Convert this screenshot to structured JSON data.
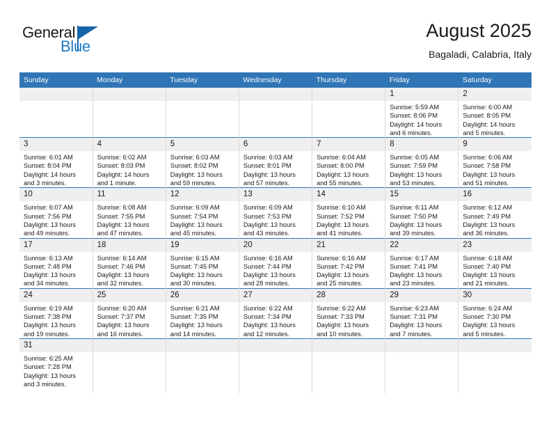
{
  "brand": {
    "name_top": "General",
    "name_bottom": "Blue",
    "flag_color": "#1565a8",
    "text_color": "#1f7ac4"
  },
  "header": {
    "title": "August 2025",
    "subtitle": "Bagaladi, Calabria, Italy"
  },
  "theme": {
    "header_blue": "#3075b5",
    "daynum_bg": "#efefef",
    "cell_border": "#d9d9d9"
  },
  "weekdays": [
    "Sunday",
    "Monday",
    "Tuesday",
    "Wednesday",
    "Thursday",
    "Friday",
    "Saturday"
  ],
  "weeks": [
    [
      {
        "day": "",
        "sunrise": "",
        "sunset": "",
        "daylight_1": "",
        "daylight_2": ""
      },
      {
        "day": "",
        "sunrise": "",
        "sunset": "",
        "daylight_1": "",
        "daylight_2": ""
      },
      {
        "day": "",
        "sunrise": "",
        "sunset": "",
        "daylight_1": "",
        "daylight_2": ""
      },
      {
        "day": "",
        "sunrise": "",
        "sunset": "",
        "daylight_1": "",
        "daylight_2": ""
      },
      {
        "day": "",
        "sunrise": "",
        "sunset": "",
        "daylight_1": "",
        "daylight_2": ""
      },
      {
        "day": "1",
        "sunrise": "Sunrise: 5:59 AM",
        "sunset": "Sunset: 8:06 PM",
        "daylight_1": "Daylight: 14 hours",
        "daylight_2": "and 6 minutes."
      },
      {
        "day": "2",
        "sunrise": "Sunrise: 6:00 AM",
        "sunset": "Sunset: 8:05 PM",
        "daylight_1": "Daylight: 14 hours",
        "daylight_2": "and 5 minutes."
      }
    ],
    [
      {
        "day": "3",
        "sunrise": "Sunrise: 6:01 AM",
        "sunset": "Sunset: 8:04 PM",
        "daylight_1": "Daylight: 14 hours",
        "daylight_2": "and 3 minutes."
      },
      {
        "day": "4",
        "sunrise": "Sunrise: 6:02 AM",
        "sunset": "Sunset: 8:03 PM",
        "daylight_1": "Daylight: 14 hours",
        "daylight_2": "and 1 minute."
      },
      {
        "day": "5",
        "sunrise": "Sunrise: 6:03 AM",
        "sunset": "Sunset: 8:02 PM",
        "daylight_1": "Daylight: 13 hours",
        "daylight_2": "and 59 minutes."
      },
      {
        "day": "6",
        "sunrise": "Sunrise: 6:03 AM",
        "sunset": "Sunset: 8:01 PM",
        "daylight_1": "Daylight: 13 hours",
        "daylight_2": "and 57 minutes."
      },
      {
        "day": "7",
        "sunrise": "Sunrise: 6:04 AM",
        "sunset": "Sunset: 8:00 PM",
        "daylight_1": "Daylight: 13 hours",
        "daylight_2": "and 55 minutes."
      },
      {
        "day": "8",
        "sunrise": "Sunrise: 6:05 AM",
        "sunset": "Sunset: 7:59 PM",
        "daylight_1": "Daylight: 13 hours",
        "daylight_2": "and 53 minutes."
      },
      {
        "day": "9",
        "sunrise": "Sunrise: 6:06 AM",
        "sunset": "Sunset: 7:58 PM",
        "daylight_1": "Daylight: 13 hours",
        "daylight_2": "and 51 minutes."
      }
    ],
    [
      {
        "day": "10",
        "sunrise": "Sunrise: 6:07 AM",
        "sunset": "Sunset: 7:56 PM",
        "daylight_1": "Daylight: 13 hours",
        "daylight_2": "and 49 minutes."
      },
      {
        "day": "11",
        "sunrise": "Sunrise: 6:08 AM",
        "sunset": "Sunset: 7:55 PM",
        "daylight_1": "Daylight: 13 hours",
        "daylight_2": "and 47 minutes."
      },
      {
        "day": "12",
        "sunrise": "Sunrise: 6:09 AM",
        "sunset": "Sunset: 7:54 PM",
        "daylight_1": "Daylight: 13 hours",
        "daylight_2": "and 45 minutes."
      },
      {
        "day": "13",
        "sunrise": "Sunrise: 6:09 AM",
        "sunset": "Sunset: 7:53 PM",
        "daylight_1": "Daylight: 13 hours",
        "daylight_2": "and 43 minutes."
      },
      {
        "day": "14",
        "sunrise": "Sunrise: 6:10 AM",
        "sunset": "Sunset: 7:52 PM",
        "daylight_1": "Daylight: 13 hours",
        "daylight_2": "and 41 minutes."
      },
      {
        "day": "15",
        "sunrise": "Sunrise: 6:11 AM",
        "sunset": "Sunset: 7:50 PM",
        "daylight_1": "Daylight: 13 hours",
        "daylight_2": "and 39 minutes."
      },
      {
        "day": "16",
        "sunrise": "Sunrise: 6:12 AM",
        "sunset": "Sunset: 7:49 PM",
        "daylight_1": "Daylight: 13 hours",
        "daylight_2": "and 36 minutes."
      }
    ],
    [
      {
        "day": "17",
        "sunrise": "Sunrise: 6:13 AM",
        "sunset": "Sunset: 7:48 PM",
        "daylight_1": "Daylight: 13 hours",
        "daylight_2": "and 34 minutes."
      },
      {
        "day": "18",
        "sunrise": "Sunrise: 6:14 AM",
        "sunset": "Sunset: 7:46 PM",
        "daylight_1": "Daylight: 13 hours",
        "daylight_2": "and 32 minutes."
      },
      {
        "day": "19",
        "sunrise": "Sunrise: 6:15 AM",
        "sunset": "Sunset: 7:45 PM",
        "daylight_1": "Daylight: 13 hours",
        "daylight_2": "and 30 minutes."
      },
      {
        "day": "20",
        "sunrise": "Sunrise: 6:16 AM",
        "sunset": "Sunset: 7:44 PM",
        "daylight_1": "Daylight: 13 hours",
        "daylight_2": "and 28 minutes."
      },
      {
        "day": "21",
        "sunrise": "Sunrise: 6:16 AM",
        "sunset": "Sunset: 7:42 PM",
        "daylight_1": "Daylight: 13 hours",
        "daylight_2": "and 25 minutes."
      },
      {
        "day": "22",
        "sunrise": "Sunrise: 6:17 AM",
        "sunset": "Sunset: 7:41 PM",
        "daylight_1": "Daylight: 13 hours",
        "daylight_2": "and 23 minutes."
      },
      {
        "day": "23",
        "sunrise": "Sunrise: 6:18 AM",
        "sunset": "Sunset: 7:40 PM",
        "daylight_1": "Daylight: 13 hours",
        "daylight_2": "and 21 minutes."
      }
    ],
    [
      {
        "day": "24",
        "sunrise": "Sunrise: 6:19 AM",
        "sunset": "Sunset: 7:38 PM",
        "daylight_1": "Daylight: 13 hours",
        "daylight_2": "and 19 minutes."
      },
      {
        "day": "25",
        "sunrise": "Sunrise: 6:20 AM",
        "sunset": "Sunset: 7:37 PM",
        "daylight_1": "Daylight: 13 hours",
        "daylight_2": "and 16 minutes."
      },
      {
        "day": "26",
        "sunrise": "Sunrise: 6:21 AM",
        "sunset": "Sunset: 7:35 PM",
        "daylight_1": "Daylight: 13 hours",
        "daylight_2": "and 14 minutes."
      },
      {
        "day": "27",
        "sunrise": "Sunrise: 6:22 AM",
        "sunset": "Sunset: 7:34 PM",
        "daylight_1": "Daylight: 13 hours",
        "daylight_2": "and 12 minutes."
      },
      {
        "day": "28",
        "sunrise": "Sunrise: 6:22 AM",
        "sunset": "Sunset: 7:33 PM",
        "daylight_1": "Daylight: 13 hours",
        "daylight_2": "and 10 minutes."
      },
      {
        "day": "29",
        "sunrise": "Sunrise: 6:23 AM",
        "sunset": "Sunset: 7:31 PM",
        "daylight_1": "Daylight: 13 hours",
        "daylight_2": "and 7 minutes."
      },
      {
        "day": "30",
        "sunrise": "Sunrise: 6:24 AM",
        "sunset": "Sunset: 7:30 PM",
        "daylight_1": "Daylight: 13 hours",
        "daylight_2": "and 5 minutes."
      }
    ],
    [
      {
        "day": "31",
        "sunrise": "Sunrise: 6:25 AM",
        "sunset": "Sunset: 7:28 PM",
        "daylight_1": "Daylight: 13 hours",
        "daylight_2": "and 3 minutes."
      },
      {
        "day": "",
        "sunrise": "",
        "sunset": "",
        "daylight_1": "",
        "daylight_2": ""
      },
      {
        "day": "",
        "sunrise": "",
        "sunset": "",
        "daylight_1": "",
        "daylight_2": ""
      },
      {
        "day": "",
        "sunrise": "",
        "sunset": "",
        "daylight_1": "",
        "daylight_2": ""
      },
      {
        "day": "",
        "sunrise": "",
        "sunset": "",
        "daylight_1": "",
        "daylight_2": ""
      },
      {
        "day": "",
        "sunrise": "",
        "sunset": "",
        "daylight_1": "",
        "daylight_2": ""
      },
      {
        "day": "",
        "sunrise": "",
        "sunset": "",
        "daylight_1": "",
        "daylight_2": ""
      }
    ]
  ]
}
